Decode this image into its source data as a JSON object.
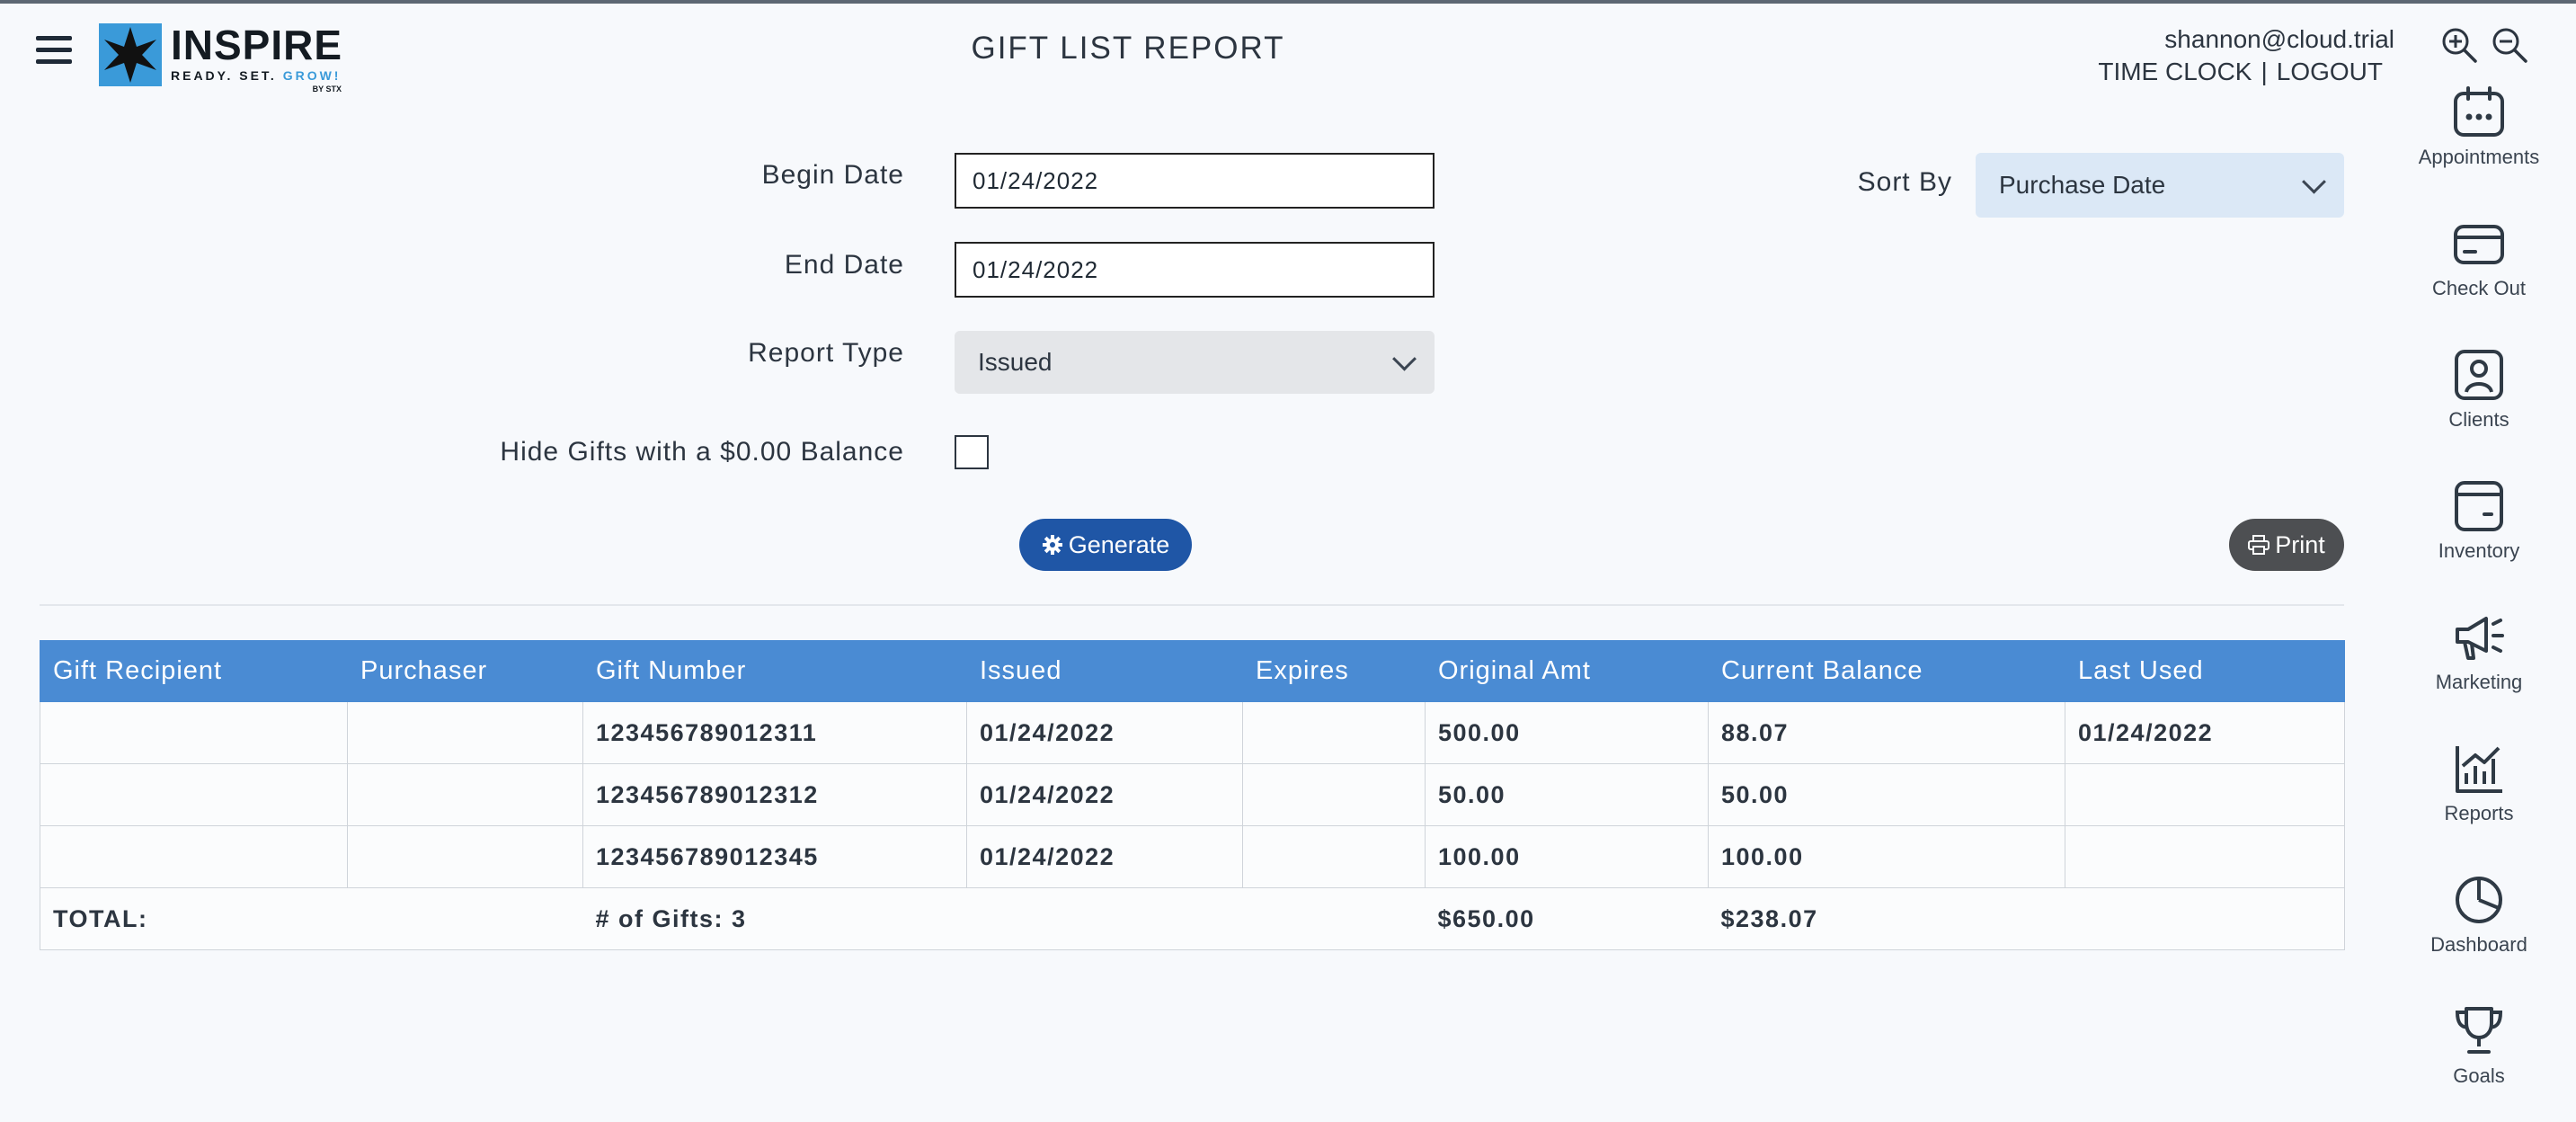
{
  "header": {
    "logo": {
      "name": "INSPIRE",
      "tagline_prefix": "READY. SET. ",
      "tagline_accent": "GROW!",
      "by": "BY STX"
    },
    "title": "GIFT LIST REPORT",
    "user_email": "shannon@cloud.trial",
    "time_clock": "TIME CLOCK",
    "separator": "|",
    "logout": "LOGOUT",
    "icons": [
      "menu-icon",
      "zoom-in-icon",
      "zoom-out-icon"
    ]
  },
  "form": {
    "begin_date_label": "Begin Date",
    "begin_date_value": "01/24/2022",
    "end_date_label": "End Date",
    "end_date_value": "01/24/2022",
    "report_type_label": "Report Type",
    "report_type_value": "Issued",
    "hide_label": "Hide Gifts with a $0.00 Balance",
    "hide_checked": false,
    "sort_by_label": "Sort By",
    "sort_by_value": "Purchase Date",
    "generate_label": "Generate",
    "print_label": "Print"
  },
  "table": {
    "columns": [
      "Gift Recipient",
      "Purchaser",
      "Gift Number",
      "Issued",
      "Expires",
      "Original Amt",
      "Current Balance",
      "Last Used"
    ],
    "rows": [
      [
        "",
        "",
        "123456789012311",
        "01/24/2022",
        "",
        "500.00",
        "88.07",
        "01/24/2022"
      ],
      [
        "",
        "",
        "123456789012312",
        "01/24/2022",
        "",
        "50.00",
        "50.00",
        ""
      ],
      [
        "",
        "",
        "123456789012345",
        "01/24/2022",
        "",
        "100.00",
        "100.00",
        ""
      ]
    ],
    "total": {
      "label": "TOTAL:",
      "count": "# of Gifts: 3",
      "original": "$650.00",
      "balance": "$238.07"
    }
  },
  "sidebar": {
    "items": [
      {
        "label": "Appointments",
        "icon": "calendar-icon"
      },
      {
        "label": "Check Out",
        "icon": "credit-card-icon"
      },
      {
        "label": "Clients",
        "icon": "user-icon"
      },
      {
        "label": "Inventory",
        "icon": "box-icon"
      },
      {
        "label": "Marketing",
        "icon": "megaphone-icon"
      },
      {
        "label": "Reports",
        "icon": "bar-chart-icon"
      },
      {
        "label": "Dashboard",
        "icon": "pie-chart-icon"
      },
      {
        "label": "Goals",
        "icon": "trophy-icon"
      }
    ]
  },
  "colors": {
    "header_blue": "#4a8bd3",
    "generate_blue": "#1f56a6",
    "print_gray": "#4d4f52",
    "select_blue": "#dbe8f6"
  }
}
